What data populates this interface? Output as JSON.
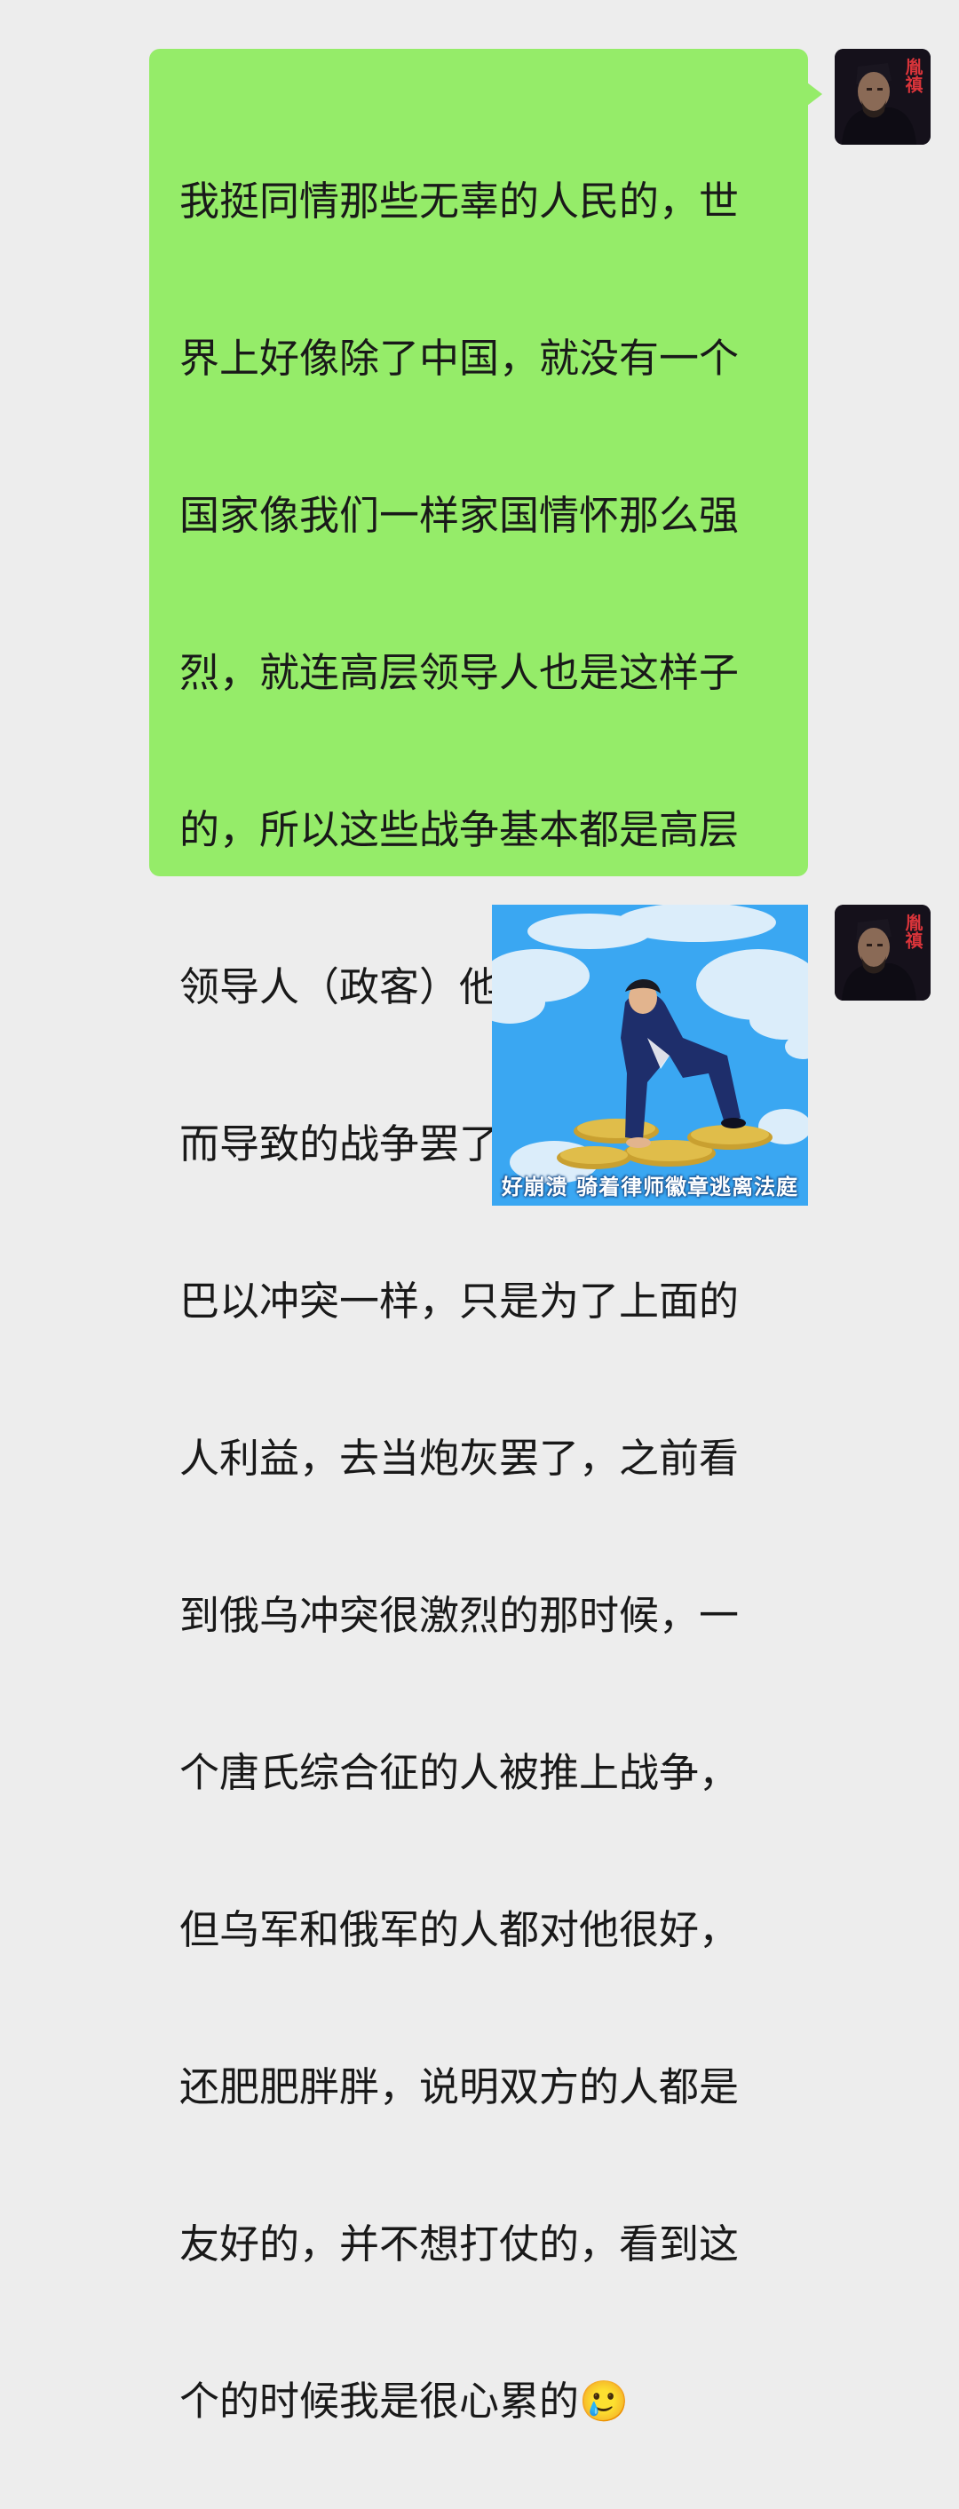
{
  "messages": [
    {
      "type": "text",
      "direction": "outgoing",
      "bubble_color": "#95ec69",
      "lines": [
        "我挺同情那些无辜的人民的，世",
        "界上好像除了中国，就没有一个",
        "国家像我们一样家国情怀那么强",
        "烈，就连高层领导人也是这样子",
        "的，所以这些战争基本都是高层",
        "领导人（政客）他们的利益不同",
        "而导致的战争罢了，就像俄乌和",
        "巴以冲突一样，只是为了上面的",
        "人利益，去当炮灰罢了，之前看",
        "到俄乌冲突很激烈的那时候，一",
        "个唐氏综合征的人被推上战争，",
        "但乌军和俄军的人都对他很好，",
        "还肥肥胖胖，说明双方的人都是",
        "友好的，并不想打仗的，看到这",
        "个的时候我是很心累的🥲"
      ],
      "avatar": {
        "icon": "user-avatar-icon",
        "text": "胤禛"
      }
    },
    {
      "type": "sticker",
      "direction": "outgoing",
      "caption": "好崩溃 骑着律师徽章逃离法庭",
      "avatar": {
        "icon": "user-avatar-icon",
        "text": "胤禛"
      }
    }
  ],
  "colors": {
    "background": "#ededed",
    "bubble": "#95ec69",
    "sky": "#3aa7f2"
  }
}
